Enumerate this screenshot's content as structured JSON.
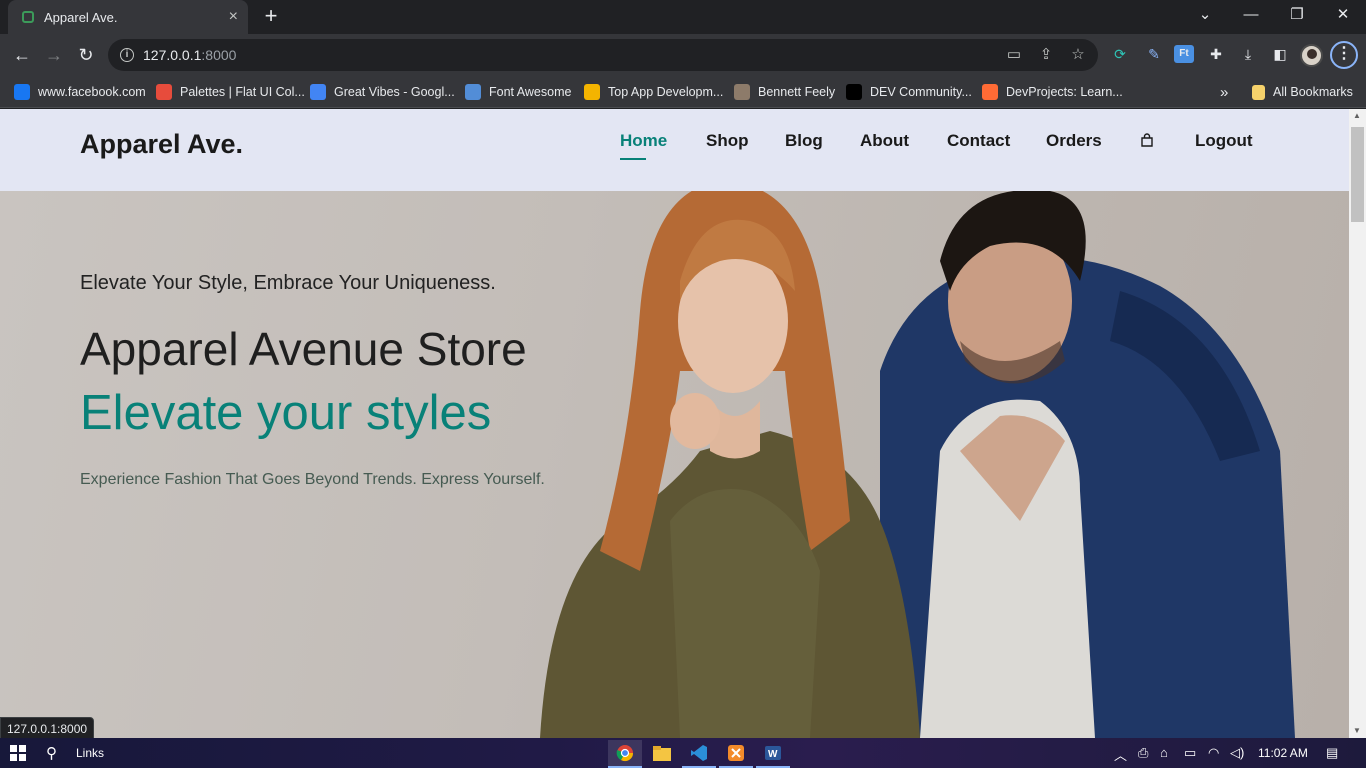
{
  "browser": {
    "tab": {
      "title": "Apparel Ave.",
      "close": "×"
    },
    "new_tab": "+",
    "window_controls": {
      "minimize": "—",
      "restore": "❐",
      "close": "✕",
      "tab_search": "⌄"
    },
    "url_host": "127.0.0.1",
    "url_port": ":8000",
    "bookmarks": [
      {
        "label": "www.facebook.com",
        "icon": "facebook-icon",
        "color": "#1877f2"
      },
      {
        "label": "Palettes | Flat UI Col...",
        "icon": "palette-icon",
        "color": "#e74c3c"
      },
      {
        "label": "Great Vibes - Googl...",
        "icon": "google-fonts-icon",
        "color": "#4285f4"
      },
      {
        "label": "Font Awesome",
        "icon": "flag-icon",
        "color": "#528dd7"
      },
      {
        "label": "Top App Developm...",
        "icon": "grid-icon",
        "color": "#f4b400"
      },
      {
        "label": "Bennett Feely",
        "icon": "avatar-icon",
        "color": "#8d7b6a"
      },
      {
        "label": "DEV Community...",
        "icon": "dev-icon",
        "color": "#000000"
      },
      {
        "label": "DevProjects: Learn...",
        "icon": "devprojects-icon",
        "color": "#ff6b35"
      }
    ],
    "more_bookmarks": "»",
    "all_bookmarks": "All Bookmarks",
    "status_url": "127.0.0.1:8000"
  },
  "site": {
    "brand": "Apparel Ave.",
    "nav": [
      "Home",
      "Shop",
      "Blog",
      "About",
      "Contact",
      "Orders",
      "Logout"
    ],
    "active_nav": "Home",
    "accent": "#088178",
    "nav_bg": "#e3e6f3",
    "hero": {
      "tagline": "Elevate Your Style, Embrace Your Uniqueness.",
      "store_name": "Apparel Avenue Store",
      "slogan": "Elevate your styles",
      "description": "Experience Fashion That Goes Beyond Trends. Express Yourself."
    }
  },
  "taskbar": {
    "search_label": "Links",
    "apps": [
      "chrome-icon",
      "file-explorer-icon",
      "vscode-icon",
      "xampp-icon",
      "word-icon"
    ],
    "time": "11:02 AM"
  }
}
